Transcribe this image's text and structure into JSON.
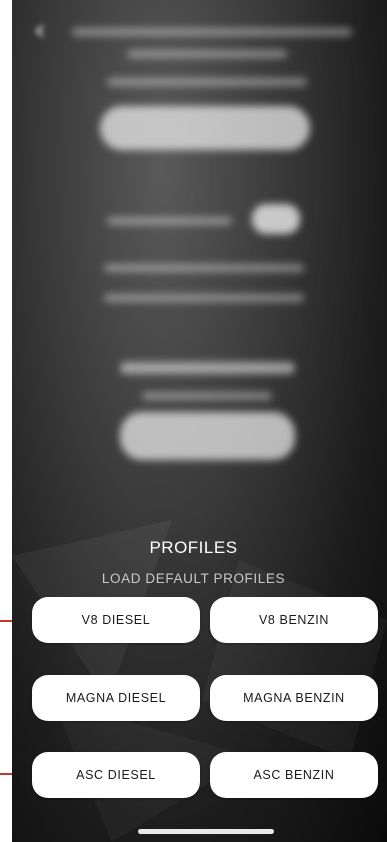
{
  "profiles": {
    "title": "PROFILES",
    "subtitle": "LOAD DEFAULT PROFILES",
    "buttons": [
      {
        "label": "V8 DIESEL"
      },
      {
        "label": "V8 BENZIN"
      },
      {
        "label": "MAGNA DIESEL"
      },
      {
        "label": "MAGNA BENZIN"
      },
      {
        "label": "ASC DIESEL"
      },
      {
        "label": "ASC BENZIN"
      }
    ]
  },
  "colors": {
    "background_dark": "#1c1c1c",
    "button_bg": "#ffffff",
    "button_text": "#1a1a1a",
    "annotation": "#c0392b"
  },
  "icons": {
    "back": "back-arrow-icon"
  }
}
